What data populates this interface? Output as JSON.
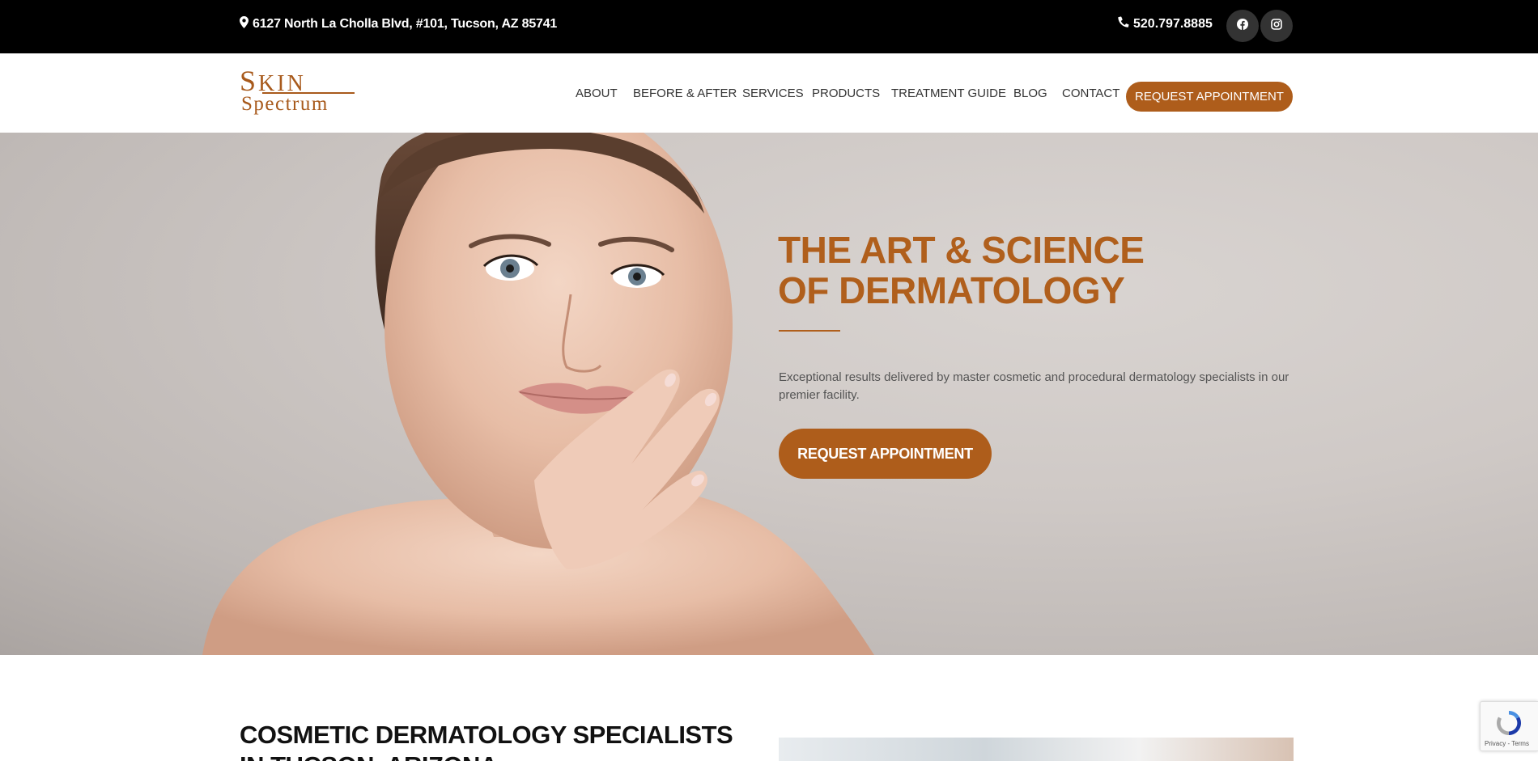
{
  "topbar": {
    "address": "6127 North La Cholla Blvd, #101, Tucson, AZ 85741",
    "phone": "520.797.8885",
    "social": [
      {
        "icon": "facebook-icon"
      },
      {
        "icon": "instagram-icon"
      }
    ]
  },
  "header": {
    "logo": {
      "line1": "Skin",
      "line2": "Spectrum"
    },
    "nav": [
      {
        "label": "ABOUT"
      },
      {
        "label": "BEFORE & AFTER"
      },
      {
        "label": "SERVICES"
      },
      {
        "label": "PRODUCTS"
      },
      {
        "label": "TREATMENT GUIDE"
      },
      {
        "label": "BLOG"
      },
      {
        "label": "CONTACT"
      }
    ],
    "cta_label": "REQUEST APPOINTMENT"
  },
  "hero": {
    "title_line1": "THE ART & SCIENCE",
    "title_line2": "OF DERMATOLOGY",
    "lead": "Exceptional results delivered by master cosmetic and procedural dermatology specialists in our premier facility.",
    "button_label": "REQUEST APPOINTMENT"
  },
  "intro": {
    "title": "COSMETIC DERMATOLOGY SPECIALISTS IN TUCSON, ARIZONA"
  },
  "recaptcha": {
    "text": "Privacy - Terms"
  },
  "colors": {
    "brand": "#ae5d1b",
    "topbar": "#000000"
  }
}
